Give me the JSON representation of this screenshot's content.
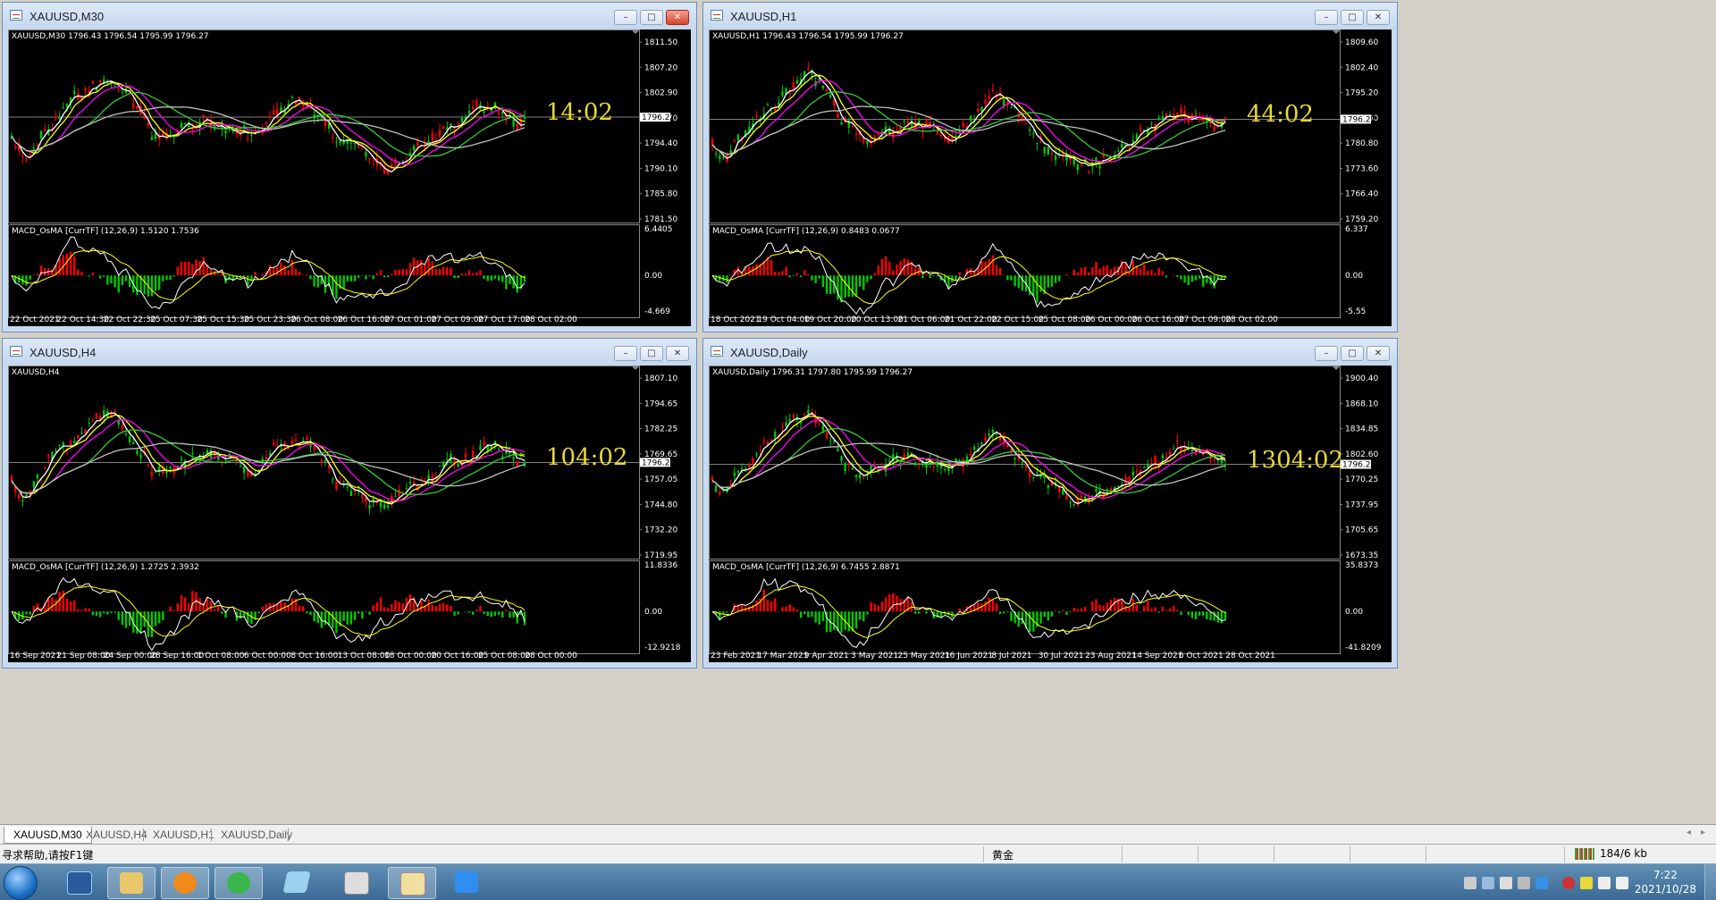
{
  "windows": [
    {
      "id": "m30",
      "title": "XAUUSD,M30",
      "ohlc_line": "XAUUSD,M30  1796.43 1796.54 1795.99 1796.27",
      "macd_line": "MACD_OsMA [CurrTF] (12,26,9) 1.5120 1.7536",
      "timer": "14:02",
      "current_price": "1796.27",
      "price_labels": [
        "1811.50",
        "1807.20",
        "1802.90",
        "1798.70",
        "1794.40",
        "1790.10",
        "1785.80",
        "1781.50"
      ],
      "macd_labels": [
        "6.4405",
        "0.00",
        "-4.669"
      ],
      "dates": [
        "22 Oct 2021",
        "22 Oct 14:30",
        "22 Oct 22:30",
        "25 Oct 07:30",
        "25 Oct 15:30",
        "25 Oct 23:30",
        "26 Oct 08:00",
        "26 Oct 16:00",
        "27 Oct 01:00",
        "27 Oct 09:00",
        "27 Oct 17:00",
        "28 Oct 02:00"
      ]
    },
    {
      "id": "h1",
      "title": "XAUUSD,H1",
      "ohlc_line": "XAUUSD,H1  1796.43 1796.54 1795.99 1796.27",
      "macd_line": "MACD_OsMA [CurrTF] (12,26,9) 0.8483 0.0677",
      "timer": "44:02",
      "current_price": "1796.27",
      "price_labels": [
        "1809.60",
        "1802.40",
        "1795.20",
        "1788.00",
        "1780.80",
        "1773.60",
        "1766.40",
        "1759.20"
      ],
      "macd_labels": [
        "6.337",
        "0.00",
        "-5.55"
      ],
      "dates": [
        "18 Oct 2021",
        "19 Oct 04:00",
        "19 Oct 20:00",
        "20 Oct 13:00",
        "21 Oct 06:00",
        "21 Oct 22:00",
        "22 Oct 15:00",
        "25 Oct 08:00",
        "26 Oct 00:00",
        "26 Oct 16:00",
        "27 Oct 09:00",
        "28 Oct 02:00"
      ]
    },
    {
      "id": "h4",
      "title": "XAUUSD,H4",
      "ohlc_line": "XAUUSD,H4",
      "macd_line": "MACD_OsMA [CurrTF] (12,26,9) 1.2725 2.3932",
      "timer": "104:02",
      "current_price": "1796.27",
      "price_labels": [
        "1807.10",
        "1794.65",
        "1782.25",
        "1769.65",
        "1757.05",
        "1744.80",
        "1732.20",
        "1719.95"
      ],
      "macd_labels": [
        "11.8336",
        "0.00",
        "-12.9218"
      ],
      "dates": [
        "16 Sep 2021",
        "21 Sep 08:00",
        "24 Sep 00:00",
        "28 Sep 16:00",
        "1 Oct 08:00",
        "6 Oct 00:00",
        "8 Oct 16:00",
        "13 Oct 08:00",
        "18 Oct 00:00",
        "20 Oct 16:00",
        "25 Oct 08:00",
        "28 Oct 00:00"
      ]
    },
    {
      "id": "d1",
      "title": "XAUUSD,Daily",
      "ohlc_line": "XAUUSD,Daily  1796.31 1797.80 1795.99 1796.27",
      "macd_line": "MACD_OsMA [CurrTF] (12,26,9) 6.7455 2.8871",
      "timer": "1304:02",
      "current_price": "1796.27",
      "price_labels": [
        "1900.40",
        "1868.10",
        "1834.85",
        "1802.60",
        "1770.25",
        "1737.95",
        "1705.65",
        "1673.35"
      ],
      "macd_labels": [
        "35.8373",
        "0.00",
        "-41.8209"
      ],
      "dates": [
        "23 Feb 2021",
        "17 Mar 2021",
        "9 Apr 2021",
        "3 May 2021",
        "25 May 2021",
        "16 Jun 2021",
        "8 Jul 2021",
        "30 Jul 2021",
        "23 Aug 2021",
        "14 Sep 2021",
        "6 Oct 2021",
        "28 Oct 2021"
      ]
    }
  ],
  "tabs": [
    "XAUUSD,M30",
    "XAUUSD,H4",
    "XAUUSD,H1",
    "XAUUSD,Daily"
  ],
  "status": {
    "help": "寻求帮助,请按F1键",
    "profile": "黄金",
    "traffic": "184/6 kb"
  },
  "taskbar": {
    "time": "7:22",
    "date": "2021/10/28",
    "apps": [
      "start-button",
      "computer",
      "explorer",
      "media-player",
      "wechat",
      "notepad",
      "archive",
      "paint",
      "mt4"
    ]
  },
  "colors": {
    "chart_bg": "#000000",
    "bull": "#00c800",
    "bear": "#ff0000",
    "ma_white": "#ffffff",
    "ma_yellow": "#ffff00",
    "ma_magenta": "#ff00ff",
    "ma_green": "#32cd32",
    "ma_gray": "#c0c0c0",
    "timer": "#e8d838"
  }
}
